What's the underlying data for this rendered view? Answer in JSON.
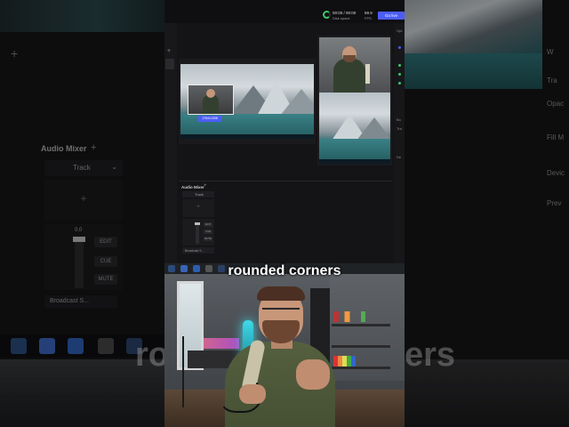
{
  "background_left": {
    "audio_mixer_title": "Audio Mixer",
    "plus": "+",
    "track_label": "Track",
    "slot_plus": "+",
    "db_value": "0.0",
    "buttons": [
      "EDIT",
      "CUE",
      "MUTE"
    ],
    "broadcast_label": "Broadcast S...",
    "big_caption": "ro"
  },
  "background_right": {
    "labels": [
      "Tra",
      "W",
      "Opac",
      "Fill M",
      "Devic",
      "Prev"
    ],
    "big_caption": "ers"
  },
  "stats": {
    "time": "00:00 / 00:00",
    "disk_label": "Disk space",
    "fps_value": "59.9",
    "fps_label": "FPS"
  },
  "go_live_label": "Go live",
  "editor": {
    "overlay_badge": "1764×1008"
  },
  "right_strip": {
    "labels": [
      "Opt",
      "Bo",
      "Tra",
      "De"
    ]
  },
  "mixer": {
    "title": "Audio Mixer",
    "plus": "+",
    "track_label": "Track",
    "slot_plus": "+",
    "buttons": [
      "EDIT",
      "CUE",
      "MUTE"
    ],
    "broadcast_label": "Broadcast S..."
  },
  "caption": "rounded corners",
  "colors": {
    "accent": "#4c5ef6",
    "panel": "#141417",
    "status_ok": "#3cc86a"
  }
}
